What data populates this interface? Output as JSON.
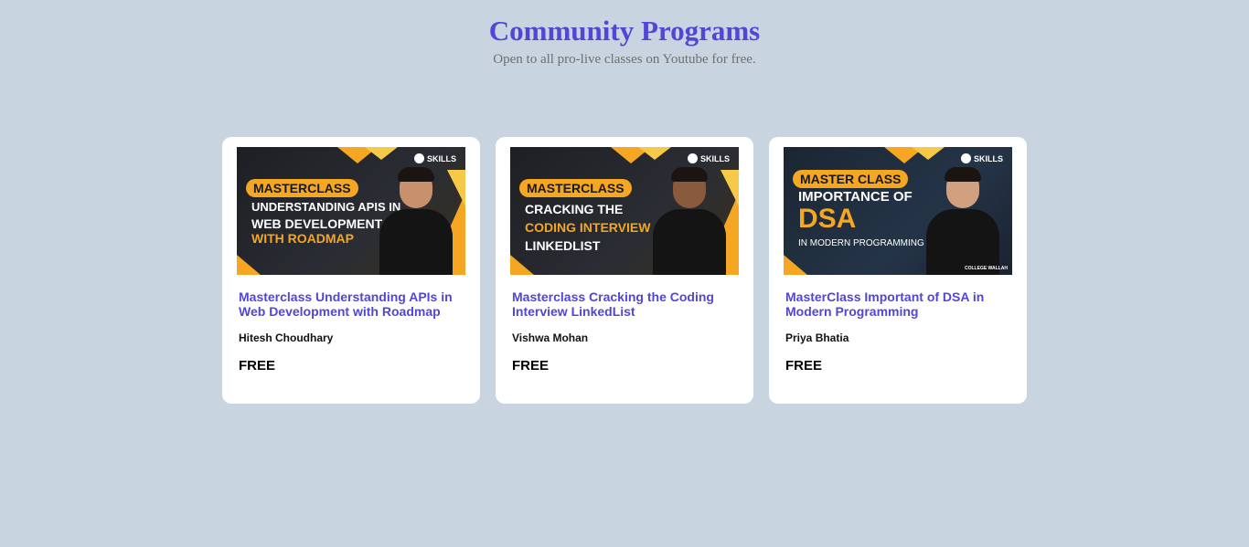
{
  "header": {
    "title": "Community Programs",
    "subtitle": "Open to all pro-live classes on Youtube for free."
  },
  "courses": [
    {
      "title": "Masterclass Understanding APIs in Web Development with Roadmap",
      "author": "Hitesh Choudhary",
      "price": "FREE",
      "thumbnail": {
        "brand": "SKILLS",
        "pill": "MASTERCLASS",
        "line1": "UNDERSTANDING APIS IN",
        "line2": "WEB DEVELOPMENT",
        "line3": "WITH ROADMAP"
      }
    },
    {
      "title": "Masterclass Cracking the Coding Interview LinkedList",
      "author": "Vishwa Mohan",
      "price": "FREE",
      "thumbnail": {
        "brand": "SKILLS",
        "pill": "MASTERCLASS",
        "line1": "CRACKING THE",
        "line2": "CODING INTERVIEW",
        "line3": "LINKEDLIST"
      }
    },
    {
      "title": "MasterClass Important of DSA in Modern Programming",
      "author": "Priya Bhatia",
      "price": "FREE",
      "thumbnail": {
        "brand": "SKILLS",
        "pill": "MASTER CLASS",
        "line1": "IMPORTANCE OF",
        "line2": "DSA",
        "line3": "IN MODERN PROGRAMMING",
        "footer": "COLLEGE WALLAH"
      }
    }
  ],
  "colors": {
    "background": "#c8d4e0",
    "accent": "#5146d6",
    "thumbnail_orange": "#f5a623"
  }
}
